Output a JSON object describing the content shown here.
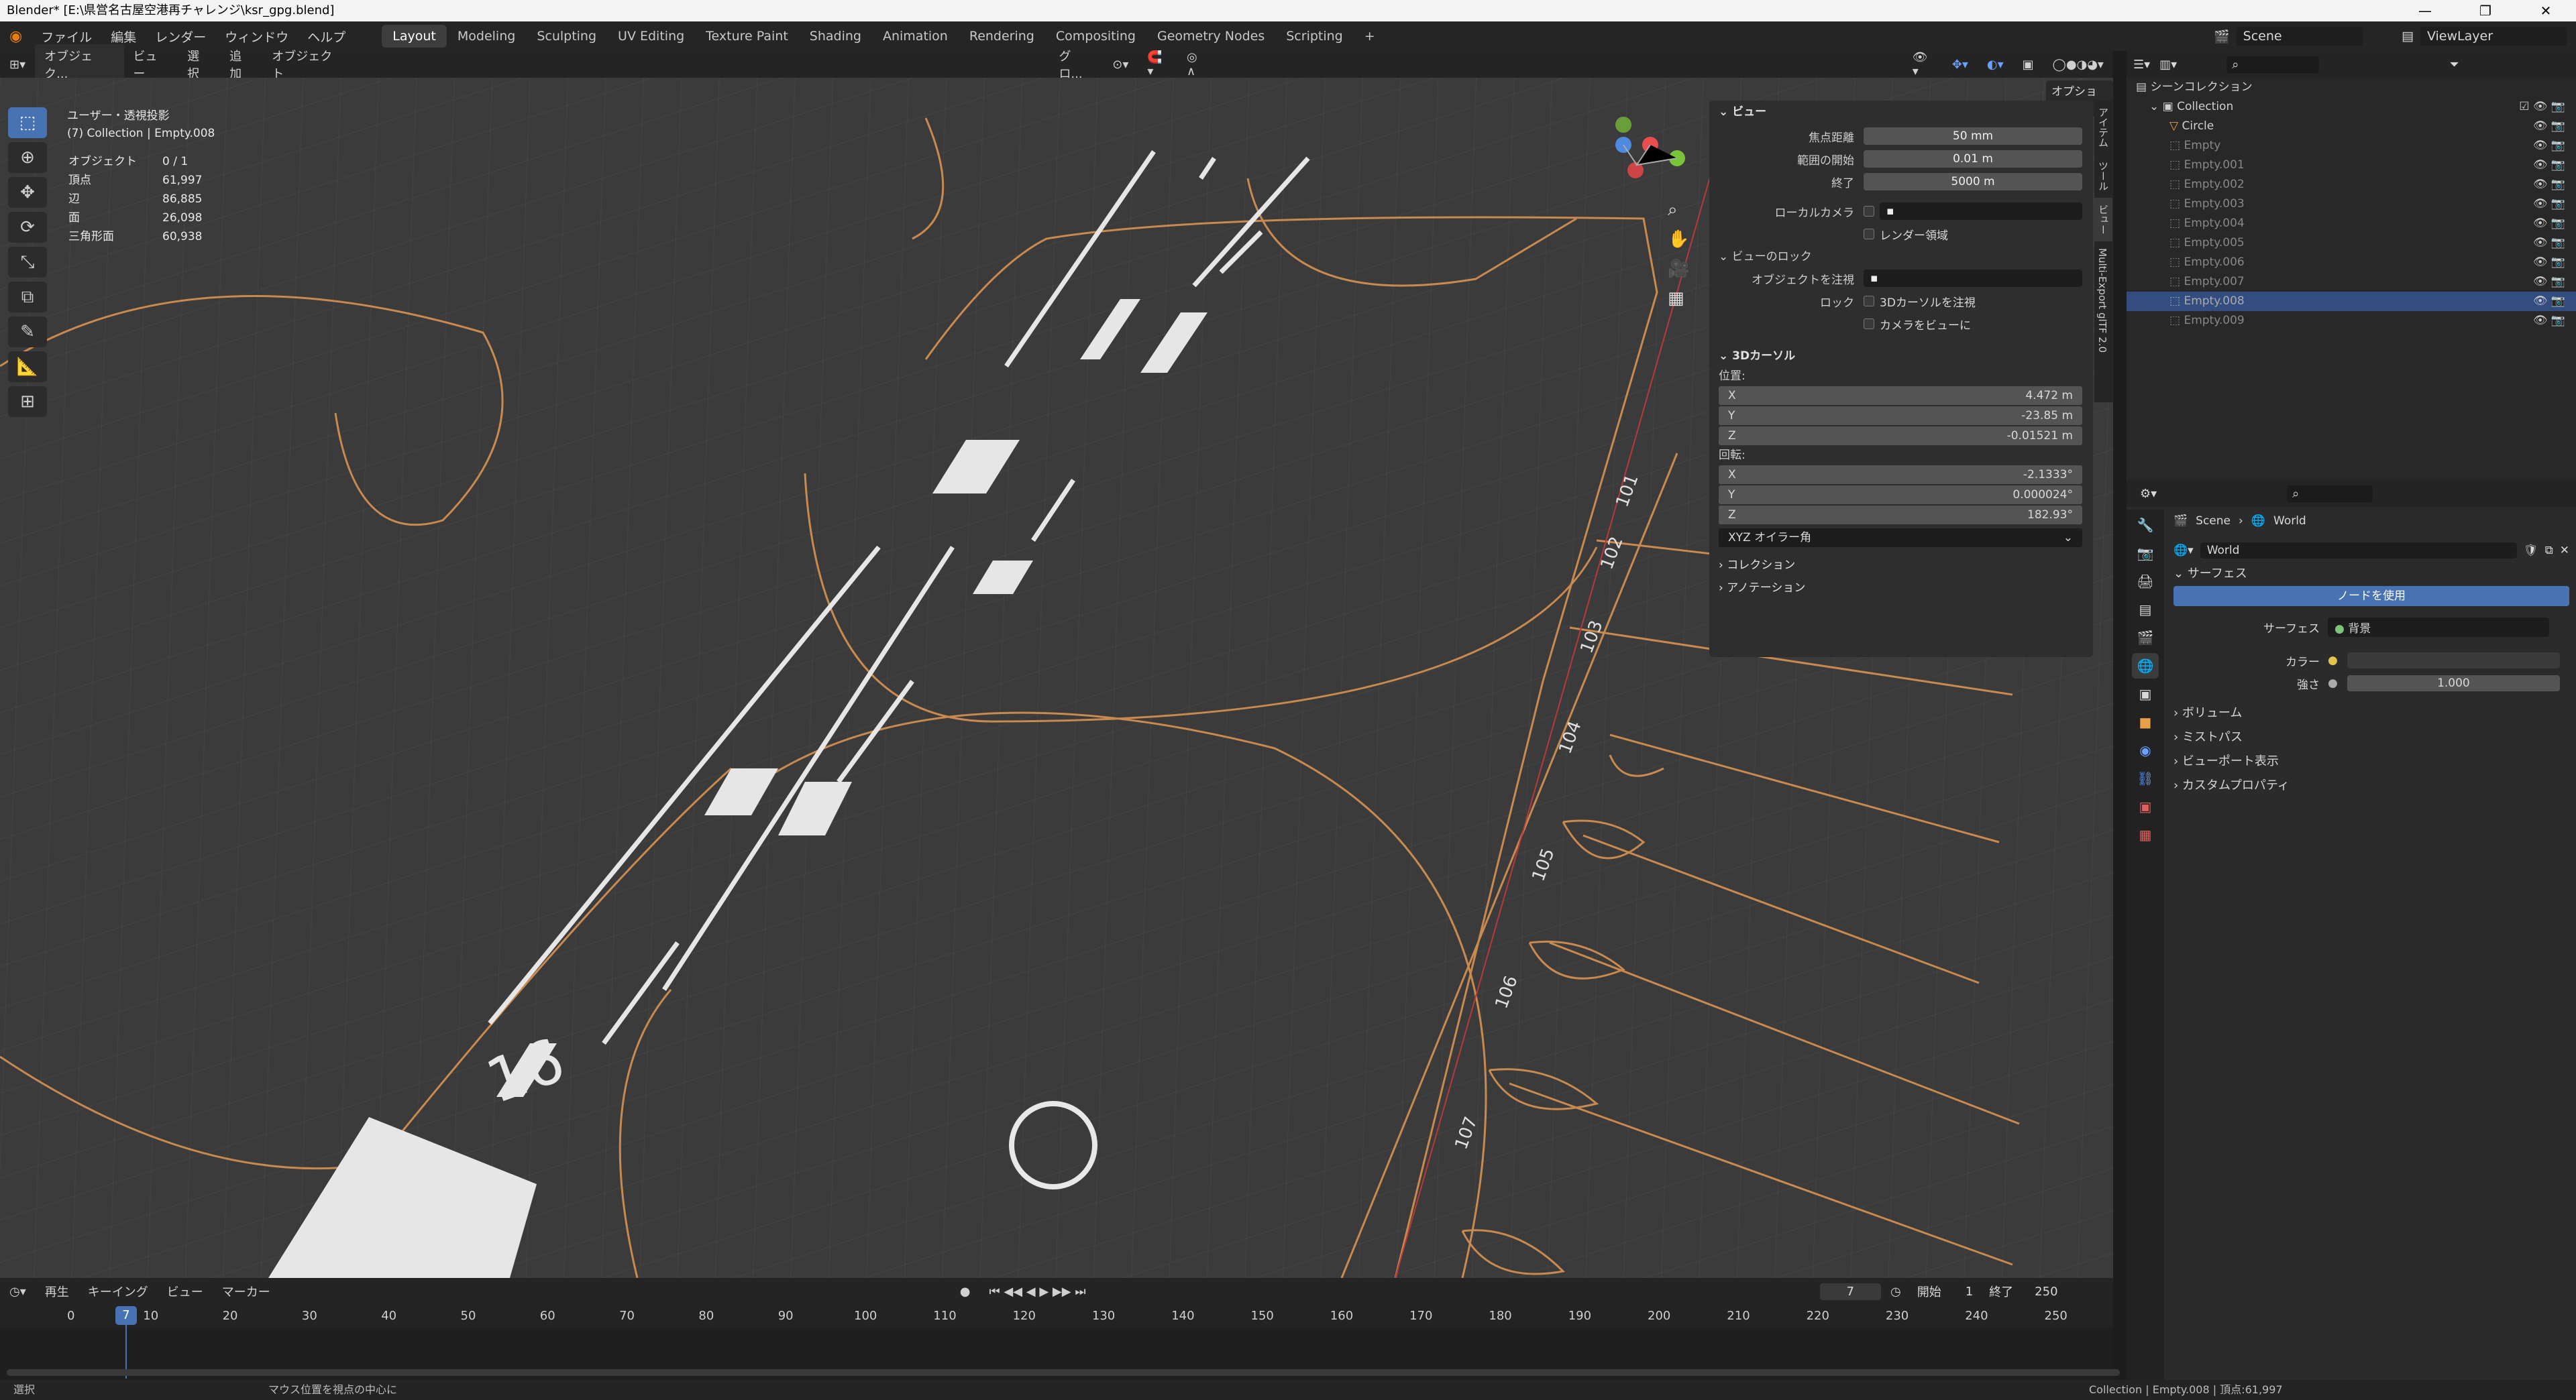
{
  "window": {
    "title": "Blender* [E:\\県営名古屋空港再チャレンジ\\ksr_gpg.blend]",
    "controls": [
      "—",
      "❐",
      "✕"
    ]
  },
  "menu": {
    "items": [
      "ファイル",
      "編集",
      "レンダー",
      "ウィンドウ",
      "ヘルプ"
    ]
  },
  "workspaces": [
    "Layout",
    "Modeling",
    "Sculpting",
    "UV Editing",
    "Texture Paint",
    "Shading",
    "Animation",
    "Rendering",
    "Compositing",
    "Geometry Nodes",
    "Scripting",
    "+"
  ],
  "scene": {
    "label": "Scene",
    "viewlayer": "ViewLayer"
  },
  "viewport_header": {
    "mode": "オブジェク...",
    "items": [
      "ビュー",
      "選択",
      "追加",
      "オブジェクト"
    ],
    "transform": "グロ...",
    "options": "オプション"
  },
  "overlay": {
    "view_name": "ユーザー・透視投影",
    "context": "(7) Collection | Empty.008",
    "stats": [
      {
        "label": "オブジェクト",
        "value": "0 / 1"
      },
      {
        "label": "頂点",
        "value": "61,997"
      },
      {
        "label": "辺",
        "value": "86,885"
      },
      {
        "label": "面",
        "value": "26,098"
      },
      {
        "label": "三角形面",
        "value": "60,938"
      }
    ]
  },
  "npanel": {
    "view_header": "ビュー",
    "focal_label": "焦点距離",
    "focal_value": "50 mm",
    "clip_start_label": "範囲の開始",
    "clip_start_value": "0.01 m",
    "clip_end_label": "終了",
    "clip_end_value": "5000 m",
    "local_camera_label": "ローカルカメラ",
    "render_region_label": "レンダー領域",
    "view_lock_header": "ビューのロック",
    "lock_object_label": "オブジェクトを注視",
    "lock_label": "ロック",
    "lock_cursor_label": "3Dカーソルを注視",
    "camera_to_view_label": "カメラをビューに",
    "cursor_header": "3Dカーソル",
    "location_label": "位置:",
    "loc": [
      {
        "axis": "X",
        "value": "4.472 m"
      },
      {
        "axis": "Y",
        "value": "-23.85 m"
      },
      {
        "axis": "Z",
        "value": "-0.01521 m"
      }
    ],
    "rotation_label": "回転:",
    "rot": [
      {
        "axis": "X",
        "value": "-2.1333°"
      },
      {
        "axis": "Y",
        "value": "0.000024°"
      },
      {
        "axis": "Z",
        "value": "182.93°"
      }
    ],
    "rot_mode": "XYZ オイラー角",
    "collection_header": "コレクション",
    "annotation_header": "アノテーション",
    "tabs": [
      "アイテム",
      "ツール",
      "ビュー",
      "Multi-Export glTF 2.0"
    ]
  },
  "outliner": {
    "scene_collection": "シーンコレクション",
    "collection": "Collection",
    "items": [
      "Circle",
      "Empty",
      "Empty.001",
      "Empty.002",
      "Empty.003",
      "Empty.004",
      "Empty.005",
      "Empty.006",
      "Empty.007",
      "Empty.008",
      "Empty.009"
    ],
    "selected": "Empty.008"
  },
  "properties": {
    "breadcrumb_scene": "Scene",
    "breadcrumb_world": "World",
    "world_name": "World",
    "surface_header": "サーフェス",
    "use_nodes": "ノードを使用",
    "surface_label": "サーフェス",
    "surface_value": "背景",
    "color_label": "カラー",
    "strength_label": "強さ",
    "strength_value": "1.000",
    "sections": [
      "ボリューム",
      "ミストパス",
      "ビューポート表示",
      "カスタムプロパティ"
    ]
  },
  "timeline": {
    "menu": [
      "再生",
      "キーイング",
      "ビュー",
      "マーカー"
    ],
    "current_frame": "7",
    "start_label": "開始",
    "start_value": "1",
    "end_label": "終了",
    "end_value": "250",
    "ticks": [
      "0",
      "10",
      "20",
      "30",
      "40",
      "50",
      "60",
      "70",
      "80",
      "90",
      "100",
      "110",
      "120",
      "130",
      "140",
      "150",
      "160",
      "170",
      "180",
      "190",
      "200",
      "210",
      "220",
      "230",
      "240",
      "250"
    ]
  },
  "statusbar": {
    "left": "選択",
    "middle": "マウス位置を視点の中心に",
    "right": "Collection | Empty.008 | 頂点:61,997"
  },
  "colors": {
    "accent": "#4772b3",
    "selection": "#334d80",
    "orange": "#c98a4f",
    "grid": "#474747"
  },
  "gate_labels": [
    "101",
    "102",
    "103",
    "104",
    "105",
    "106",
    "107"
  ],
  "runway_number": "16"
}
